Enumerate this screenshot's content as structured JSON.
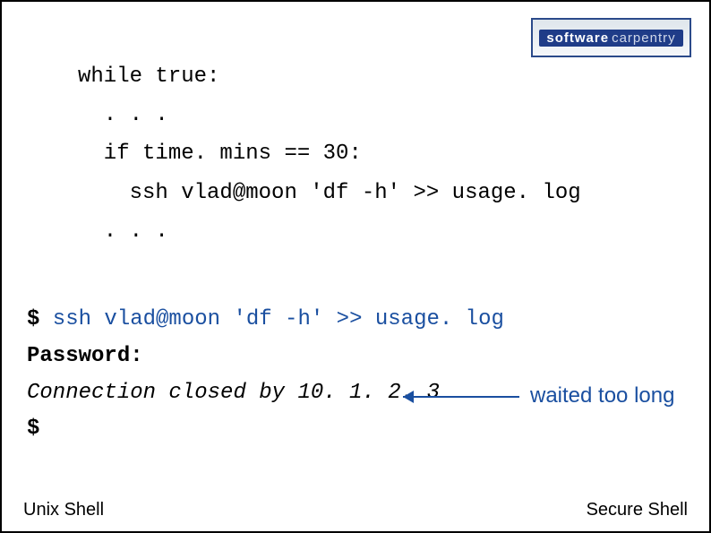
{
  "logo": {
    "part1": "software",
    "part2": "carpentry"
  },
  "code": {
    "line1": "while true:",
    "line2": "  . . .",
    "line3": "  if time. mins == 30:",
    "line4": "    ssh vlad@moon 'df -h' >> usage. log",
    "line5": "  . . ."
  },
  "terminal": {
    "prompt1": "$",
    "cmd1": " ssh vlad@moon 'df -h' >> usage. log",
    "pwd": "Password:",
    "closed": "Connection closed by 10. 1. 2. 3",
    "prompt2": "$"
  },
  "annotation": "waited too long",
  "footer": {
    "left": "Unix Shell",
    "right": "Secure Shell"
  }
}
